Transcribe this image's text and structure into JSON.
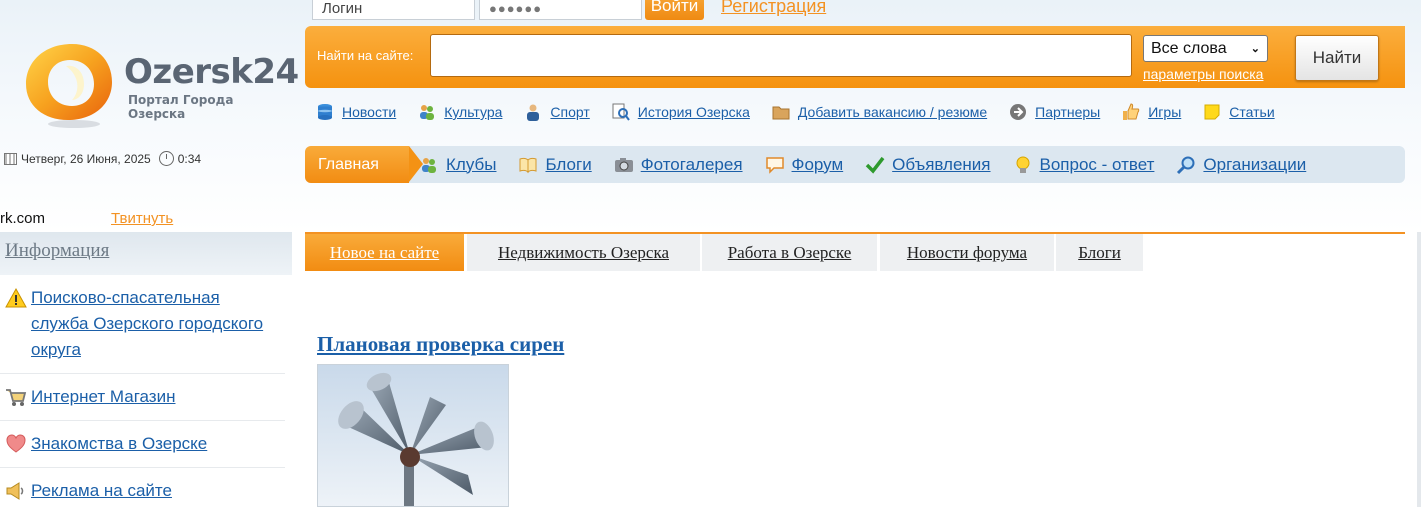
{
  "logo": {
    "name": "Ozersk24",
    "subtitle": "Портал Города Озерска"
  },
  "datetime": {
    "date": "Четверг, 26 Июня, 2025",
    "time": "0:34"
  },
  "login": {
    "login_placeholder": "Логин",
    "password_mask": "●●●●●●",
    "login_button": "Войти",
    "register_link": "Регистрация"
  },
  "search": {
    "label": "Найти на сайте:",
    "value": "",
    "mode": "Все слова",
    "params_link": "параметры поиска",
    "button": "Найти"
  },
  "icon_nav": [
    {
      "label": "Новости",
      "icon": "database-icon"
    },
    {
      "label": "Культура",
      "icon": "people-icon"
    },
    {
      "label": "Спорт",
      "icon": "person-icon"
    },
    {
      "label": "История Озерска",
      "icon": "magnifier-doc-icon"
    },
    {
      "label": "Добавить вакансию / резюме",
      "icon": "folder-icon"
    },
    {
      "label": "Партнеры",
      "icon": "arrow-circle-icon"
    },
    {
      "label": "Игры",
      "icon": "thumbs-up-icon"
    },
    {
      "label": "Статьи",
      "icon": "note-icon"
    }
  ],
  "main_nav": {
    "home": "Главная",
    "items": [
      {
        "label": "Клубы",
        "icon": "people-icon"
      },
      {
        "label": "Блоги",
        "icon": "book-icon"
      },
      {
        "label": "Фотогалерея",
        "icon": "camera-icon"
      },
      {
        "label": "Форум",
        "icon": "speech-bubble-icon"
      },
      {
        "label": "Объявления",
        "icon": "checkmark-icon"
      },
      {
        "label": "Вопрос - ответ",
        "icon": "lightbulb-icon"
      },
      {
        "label": "Организации",
        "icon": "search-icon"
      }
    ]
  },
  "share": {
    "text": "rk.com",
    "tweet": "Твитнуть"
  },
  "sidebar": {
    "title": "Информация",
    "items": [
      {
        "label": "Поисково-спасательная служба Озерского городского округа",
        "icon": "warning-icon"
      },
      {
        "label": "Интернет Магазин",
        "icon": "cart-icon"
      },
      {
        "label": "Знакомства в Озерске",
        "icon": "heart-icon"
      },
      {
        "label": "Реклама на сайте",
        "icon": "megaphone-icon"
      }
    ]
  },
  "tabs": [
    {
      "label": "Новое на сайте",
      "active": true
    },
    {
      "label": "Недвижимость Озерска",
      "active": false
    },
    {
      "label": "Работа в Озерске",
      "active": false
    },
    {
      "label": "Новости форума",
      "active": false
    },
    {
      "label": "Блоги",
      "active": false
    }
  ],
  "article": {
    "title": "Плановая проверка сирен"
  },
  "colors": {
    "accent": "#f39223",
    "link": "#1b5fa8",
    "nav_bg": "#dce7f0"
  }
}
